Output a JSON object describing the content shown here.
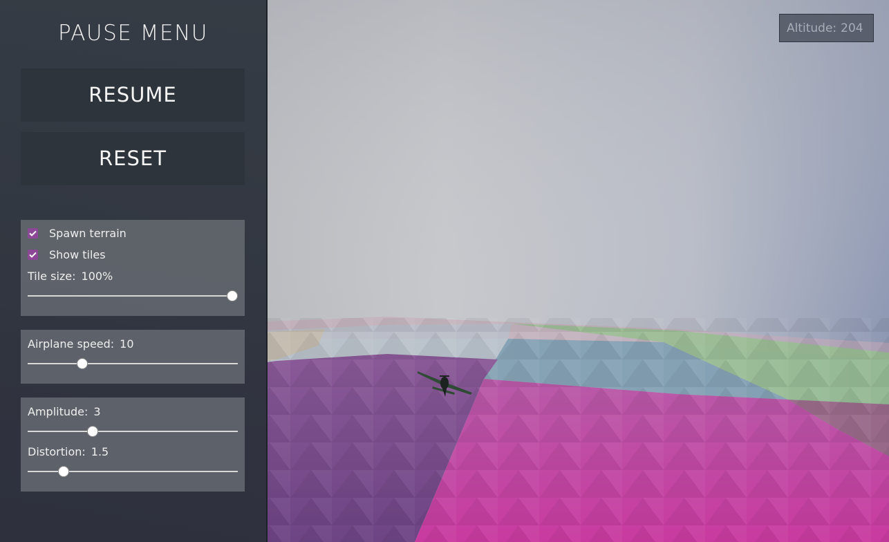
{
  "hud": {
    "altitude_label": "Altitude:",
    "altitude_value": "204"
  },
  "menu": {
    "title": "PAUSE MENU",
    "resume_label": "RESUME",
    "reset_label": "RESET"
  },
  "terrain_panel": {
    "spawn_terrain": {
      "label": "Spawn terrain",
      "checked": true
    },
    "show_tiles": {
      "label": "Show tiles",
      "checked": true
    },
    "tile_size": {
      "label": "Tile size:",
      "value": "100%",
      "fraction": 1.0
    }
  },
  "speed_panel": {
    "airplane_speed": {
      "label": "Airplane speed:",
      "value": "10",
      "fraction": 0.26
    }
  },
  "noise_panel": {
    "amplitude": {
      "label": "Amplitude:",
      "value": "3",
      "fraction": 0.31
    },
    "distortion": {
      "label": "Distortion:",
      "value": "1.5",
      "fraction": 0.17
    }
  },
  "colors": {
    "sky_top": "#a3a6ad",
    "sky_right": "#8e99b4",
    "terrain_magenta": "#c0489f",
    "terrain_purple": "#7c4d8e",
    "terrain_green": "#8fb58a",
    "terrain_blue": "#7f9dae",
    "checkbox_accent": "#8c4896",
    "airplane": "#2c3a2e"
  },
  "icons": {
    "checkbox": "check-icon",
    "airplane": "airplane-model"
  }
}
